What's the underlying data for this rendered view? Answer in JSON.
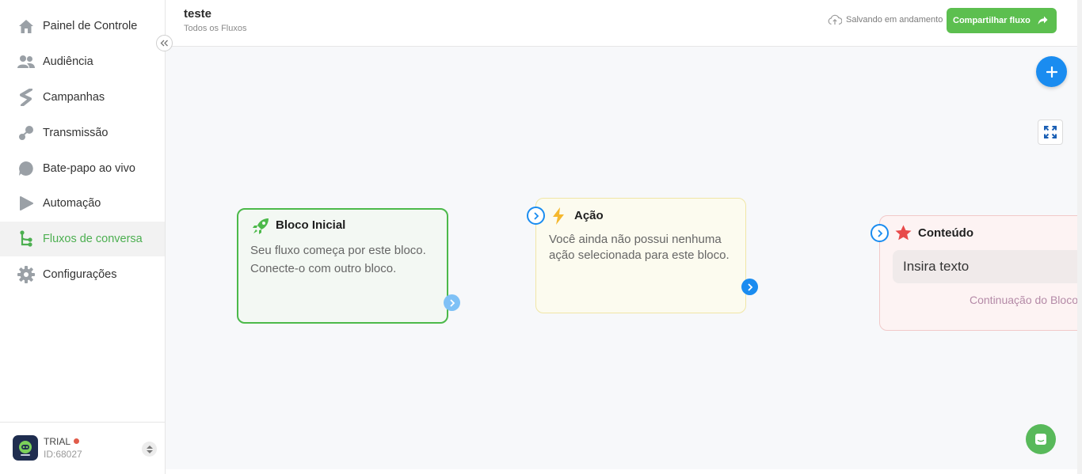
{
  "sidebar": {
    "items": [
      {
        "label": "Painel de Controle",
        "icon": "home-icon"
      },
      {
        "label": "Audiência",
        "icon": "users-icon"
      },
      {
        "label": "Campanhas",
        "icon": "campaign-icon"
      },
      {
        "label": "Transmissão",
        "icon": "broadcast-icon"
      },
      {
        "label": "Bate-papo ao vivo",
        "icon": "chat-bubble-icon"
      },
      {
        "label": "Automação",
        "icon": "automation-icon"
      },
      {
        "label": "Fluxos de conversa",
        "icon": "flow-icon",
        "active": true
      },
      {
        "label": "Configurações",
        "icon": "gear-icon"
      }
    ],
    "footer": {
      "plan": "TRIAL",
      "account_id": "ID:68027"
    }
  },
  "header": {
    "title": "teste",
    "breadcrumb": "Todos os Fluxos",
    "saving_status": "Salvando em andamento",
    "share_label": "Compartilhar fluxo"
  },
  "blocks": {
    "start": {
      "title": "Bloco Inicial",
      "description_line1": "Seu fluxo começa por este bloco.",
      "description_line2": "Conecte-o com outro bloco."
    },
    "action": {
      "title": "Ação",
      "description_line1": "Você ainda não possui nenhuma",
      "description_line2": "ação selecionada para este bloco."
    },
    "content": {
      "title": "Conteúdo",
      "input_text": "Insira texto",
      "continuation": "Continuação do Bloco"
    }
  },
  "colors": {
    "accent_green": "#4caf50",
    "primary_blue": "#1a8cf0",
    "share_button": "#5cbf4f"
  }
}
